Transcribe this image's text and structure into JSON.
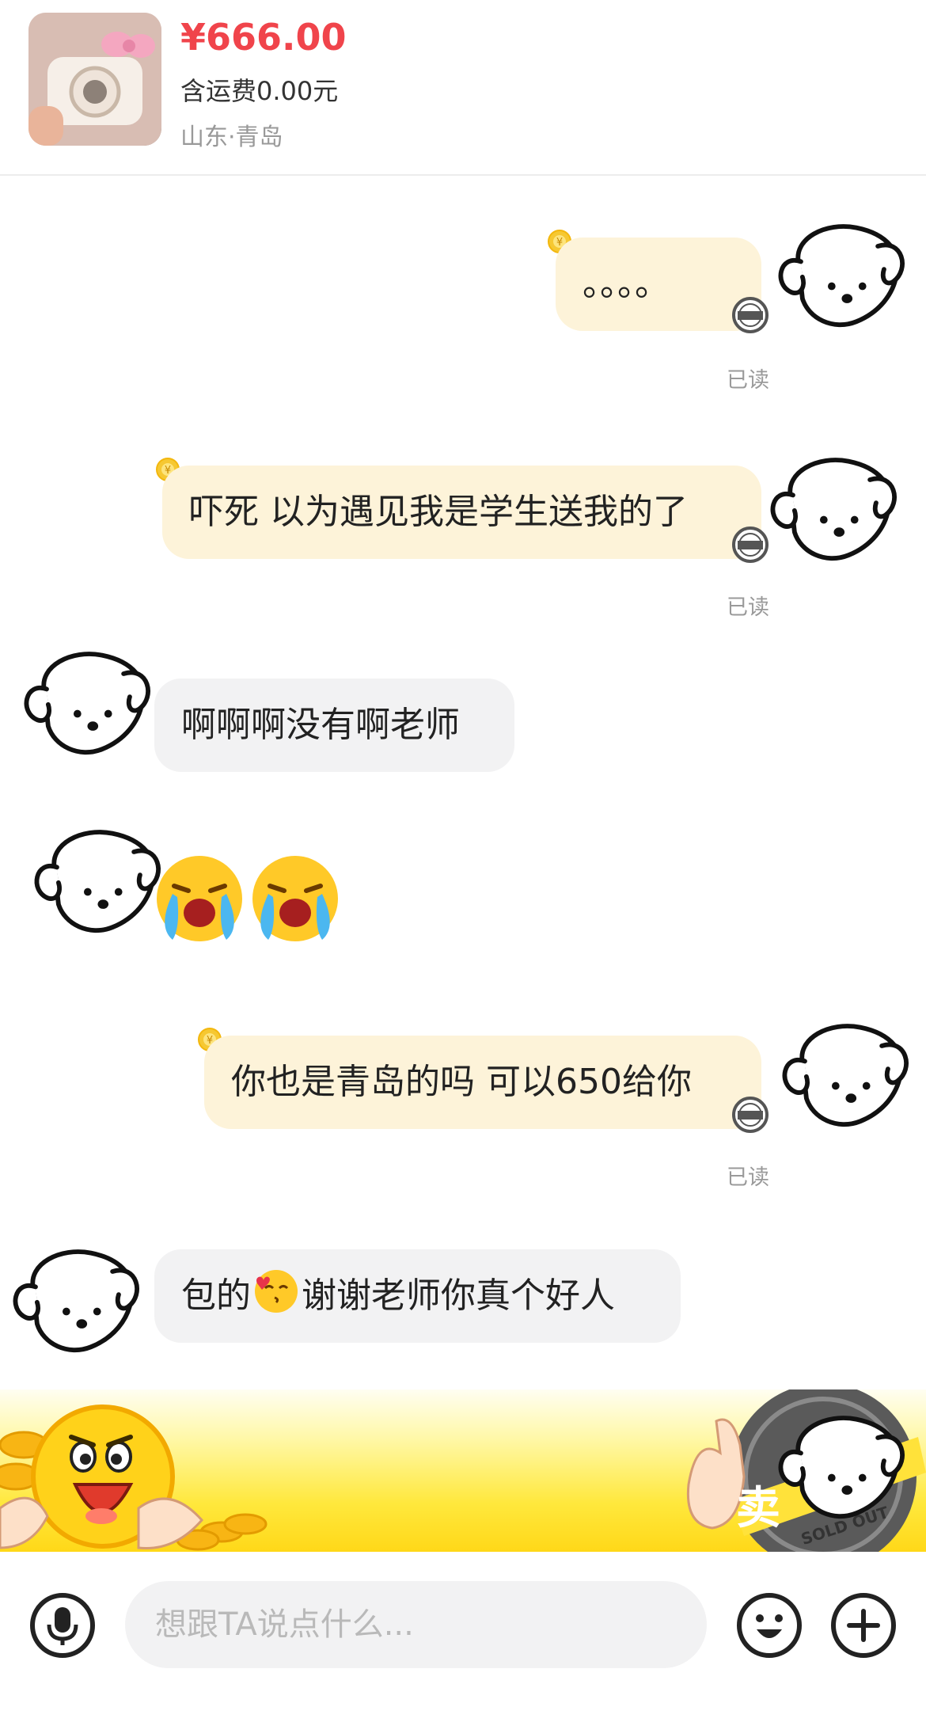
{
  "product": {
    "price": "¥666.00",
    "shipping": "含运费0.00元",
    "location": "山东·青岛"
  },
  "messages": [
    {
      "side": "out",
      "text": "。。。。",
      "status": "已读",
      "badge": "卖掉了"
    },
    {
      "side": "out",
      "text": "吓死 以为遇见我是学生送我的了",
      "status": "已读",
      "badge": "卖掉了"
    },
    {
      "side": "in",
      "text": "啊啊啊没有啊老师"
    },
    {
      "side": "in",
      "emoji": "crying-face-emoji"
    },
    {
      "side": "out",
      "text": "你也是青岛的吗 可以650给你",
      "status": "已读",
      "badge": "卖掉了"
    },
    {
      "side": "in",
      "text_before": "包的",
      "emoji": "kissing-heart-emoji",
      "text_after": "谢谢老师你真个好人"
    }
  ],
  "banner": {
    "stamp_text": "卖",
    "stamp_en": "SOLD OUT"
  },
  "input": {
    "placeholder": "想跟TA说点什么..."
  },
  "icons": {
    "voice": "microphone-icon",
    "emoji": "smiley-icon",
    "more": "plus-icon"
  },
  "colors": {
    "price": "#f0444b",
    "outgoing_bubble": "#fdf3d9",
    "incoming_bubble": "#f2f2f3",
    "banner_yellow": "#ffe83d"
  }
}
